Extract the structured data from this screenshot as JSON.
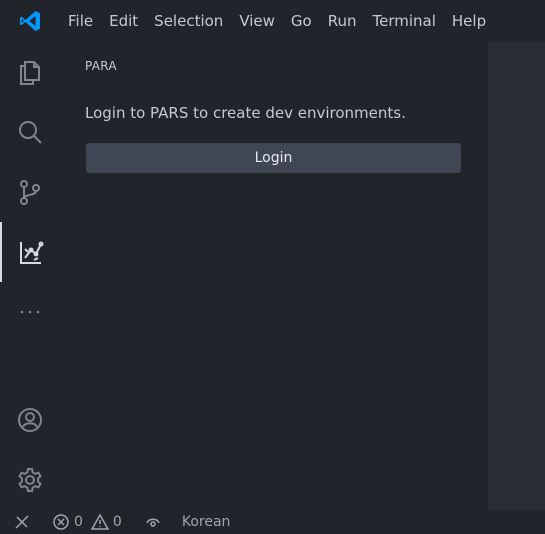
{
  "menu": {
    "items": [
      "File",
      "Edit",
      "Selection",
      "View",
      "Go",
      "Run",
      "Terminal",
      "Help"
    ]
  },
  "activity_bar": {
    "items": [
      "files-icon",
      "search-icon",
      "source-control-icon",
      "para-extension-icon",
      "more-icon"
    ],
    "bottom_items": [
      "account-icon",
      "settings-gear-icon"
    ],
    "active": "para-extension-icon"
  },
  "sidebar": {
    "title": "PARA",
    "message": "Login to PARS to create dev environments.",
    "login_button": "Login"
  },
  "status_bar": {
    "errors": "0",
    "warnings": "0",
    "language": "Korean"
  },
  "colors": {
    "background": "#282c34",
    "sidebar": "#21252b",
    "button": "#404754",
    "logo_accent": "#0098ff"
  }
}
